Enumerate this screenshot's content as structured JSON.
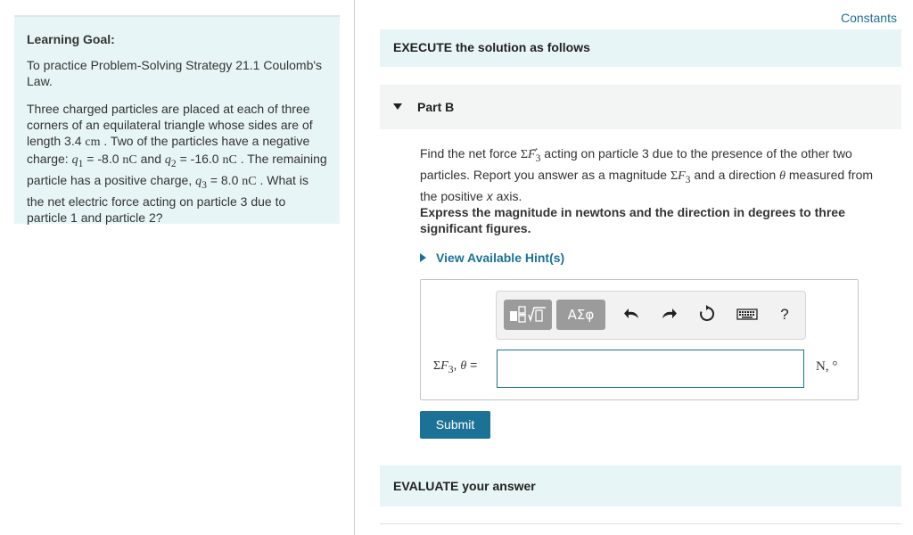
{
  "learning_goal": {
    "title": "Learning Goal:",
    "text": "To practice Problem-Solving Strategy 21.1 Coulomb's Law.",
    "problem": {
      "p1": "Three charged particles are placed at each of three corners of an equilateral triangle whose sides are of length 3.4 ",
      "u_cm": "cm",
      "p2": " . Two of the particles have a negative charge: ",
      "q1_sym": "q",
      "q1_sub": "1",
      "p3": " = -8.0 ",
      "u_nc1": "nC",
      "p4": " and ",
      "q2_sym": "q",
      "q2_sub": "2",
      "p5": " = -16.0 ",
      "u_nc2": "nC",
      "p6": " . The remaining particle has a positive charge, ",
      "q3_sym": "q",
      "q3_sub": "3",
      "p7": " = 8.0 ",
      "u_nc3": "nC",
      "p8": " . What is the net electric force acting on particle 3 due to particle 1 and particle 2?"
    }
  },
  "constants_link": "Constants",
  "execute_title": "EXECUTE the solution as follows",
  "part_label": "Part B",
  "question": {
    "p1": "Find the net force ",
    "sigma": "Σ",
    "f": "F",
    "sub": "3",
    "p2": " acting on particle 3 due to the presence of the other two particles. Report you answer as a magnitude ",
    "p3": " and a direction ",
    "theta": "θ",
    "p4": " measured from the positive ",
    "x": "x",
    "p5": " axis."
  },
  "instructions": "Express the magnitude in newtons and the direction in degrees to three significant figures.",
  "hints_label": "View Available Hint(s)",
  "toolbar": {
    "greek_label": "ΑΣφ",
    "undo_icon": "undo-icon",
    "redo_icon": "redo-icon",
    "reset_icon": "reset-icon",
    "keyboard_icon": "keyboard-icon",
    "help_label": "?"
  },
  "answer": {
    "label_sigma": "Σ",
    "label_f": "F",
    "label_sub": "3",
    "label_sep": ", ",
    "label_theta": "θ",
    "label_eq": " =",
    "value": "",
    "units": "N, °"
  },
  "submit_label": "Submit",
  "evaluate_title": "EVALUATE your answer",
  "colors": {
    "accent": "#1c7196",
    "panel_bg": "#e8f5f6",
    "part_bg": "#f3f4f4"
  }
}
